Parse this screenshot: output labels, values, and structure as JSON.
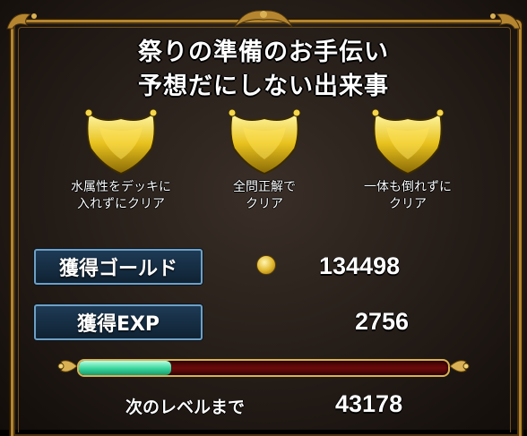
{
  "title_line1": "祭りの準備のお手伝い",
  "title_line2": "予想だにしない出来事",
  "missions": [
    {
      "icon": "gold-crown-emblem-icon",
      "line1": "水属性をデッキに",
      "line2": "入れずにクリア"
    },
    {
      "icon": "gold-crown-emblem-icon",
      "line1": "全問正解で",
      "line2": "クリア"
    },
    {
      "icon": "gold-crown-emblem-icon",
      "line1": "一体も倒れずに",
      "line2": "クリア"
    }
  ],
  "gold": {
    "label": "獲得ゴールド",
    "icon": "gold-coin-icon",
    "value": "134498"
  },
  "exp": {
    "label": "獲得EXP",
    "value": "2756"
  },
  "level_progress": 0.25,
  "next_level": {
    "label": "次のレベルまで",
    "value": "43178"
  },
  "colors": {
    "gold": "#d9b154",
    "bar_fill": "#37d59c",
    "label_box": "#1e3a55"
  }
}
